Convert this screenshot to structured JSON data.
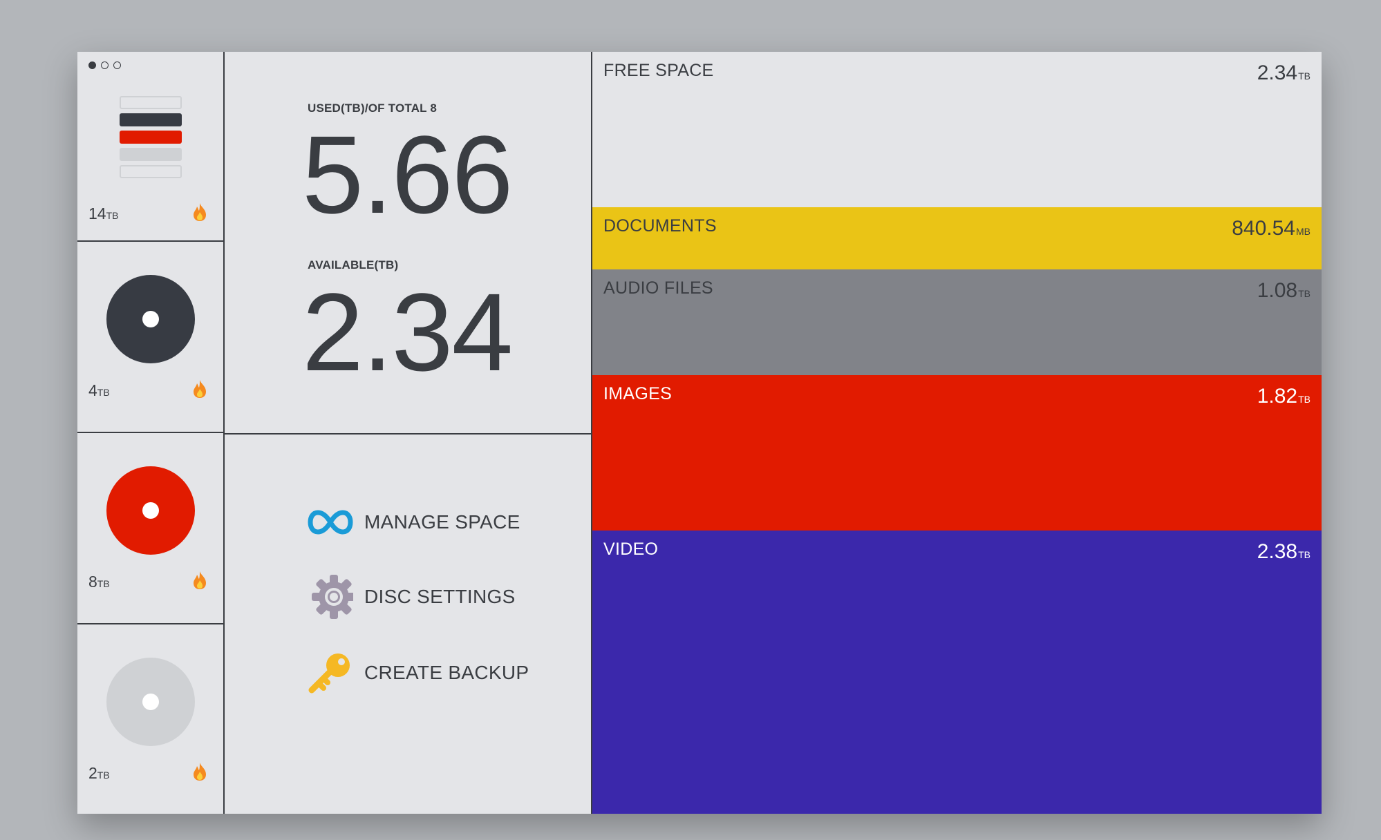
{
  "pager": {
    "dots": 3,
    "active": 0
  },
  "disks": [
    {
      "type": "stack",
      "capacity": "14",
      "unit": "TB",
      "icon": "flame-icon"
    },
    {
      "type": "disc",
      "color": "#373b43",
      "capacity": "4",
      "unit": "TB",
      "icon": "flame-icon"
    },
    {
      "type": "disc",
      "color": "#e11b00",
      "capacity": "8",
      "unit": "TB",
      "icon": "flame-icon"
    },
    {
      "type": "disc",
      "color": "#cfd1d4",
      "capacity": "2",
      "unit": "TB",
      "icon": "flame-icon"
    }
  ],
  "stack_colors": [
    "#e4e5e8",
    "#373b43",
    "#e11b00",
    "#cfd1d4",
    "#e4e5e8"
  ],
  "stats": {
    "used_label": "USED(TB)/OF TOTAL 8",
    "used_value": "5.66",
    "available_label": "AVAILABLE(TB)",
    "available_value": "2.34"
  },
  "actions": [
    {
      "label": "MANAGE SPACE",
      "icon": "infinity-icon",
      "color": "#1a9bd7"
    },
    {
      "label": "DISC SETTINGS",
      "icon": "gear-icon",
      "color": "#9e95a8"
    },
    {
      "label": "CREATE BACKUP",
      "icon": "key-icon",
      "color": "#f5b824"
    }
  ],
  "storage": [
    {
      "name": "FREE SPACE",
      "value": "2.34",
      "unit": "TB",
      "bg": "#e4e5e8",
      "fg": "#3a3d42"
    },
    {
      "name": "DOCUMENTS",
      "value": "840.54",
      "unit": "MB",
      "bg": "#eac416",
      "fg": "#3a3d42"
    },
    {
      "name": "AUDIO FILES",
      "value": "1.08",
      "unit": "TB",
      "bg": "#818389",
      "fg": "#3a3d42"
    },
    {
      "name": "IMAGES",
      "value": "1.82",
      "unit": "TB",
      "bg": "#e11b00",
      "fg": "#ffffff"
    },
    {
      "name": "VIDEO",
      "value": "2.38",
      "unit": "TB",
      "bg": "#3b28ab",
      "fg": "#ffffff"
    }
  ]
}
